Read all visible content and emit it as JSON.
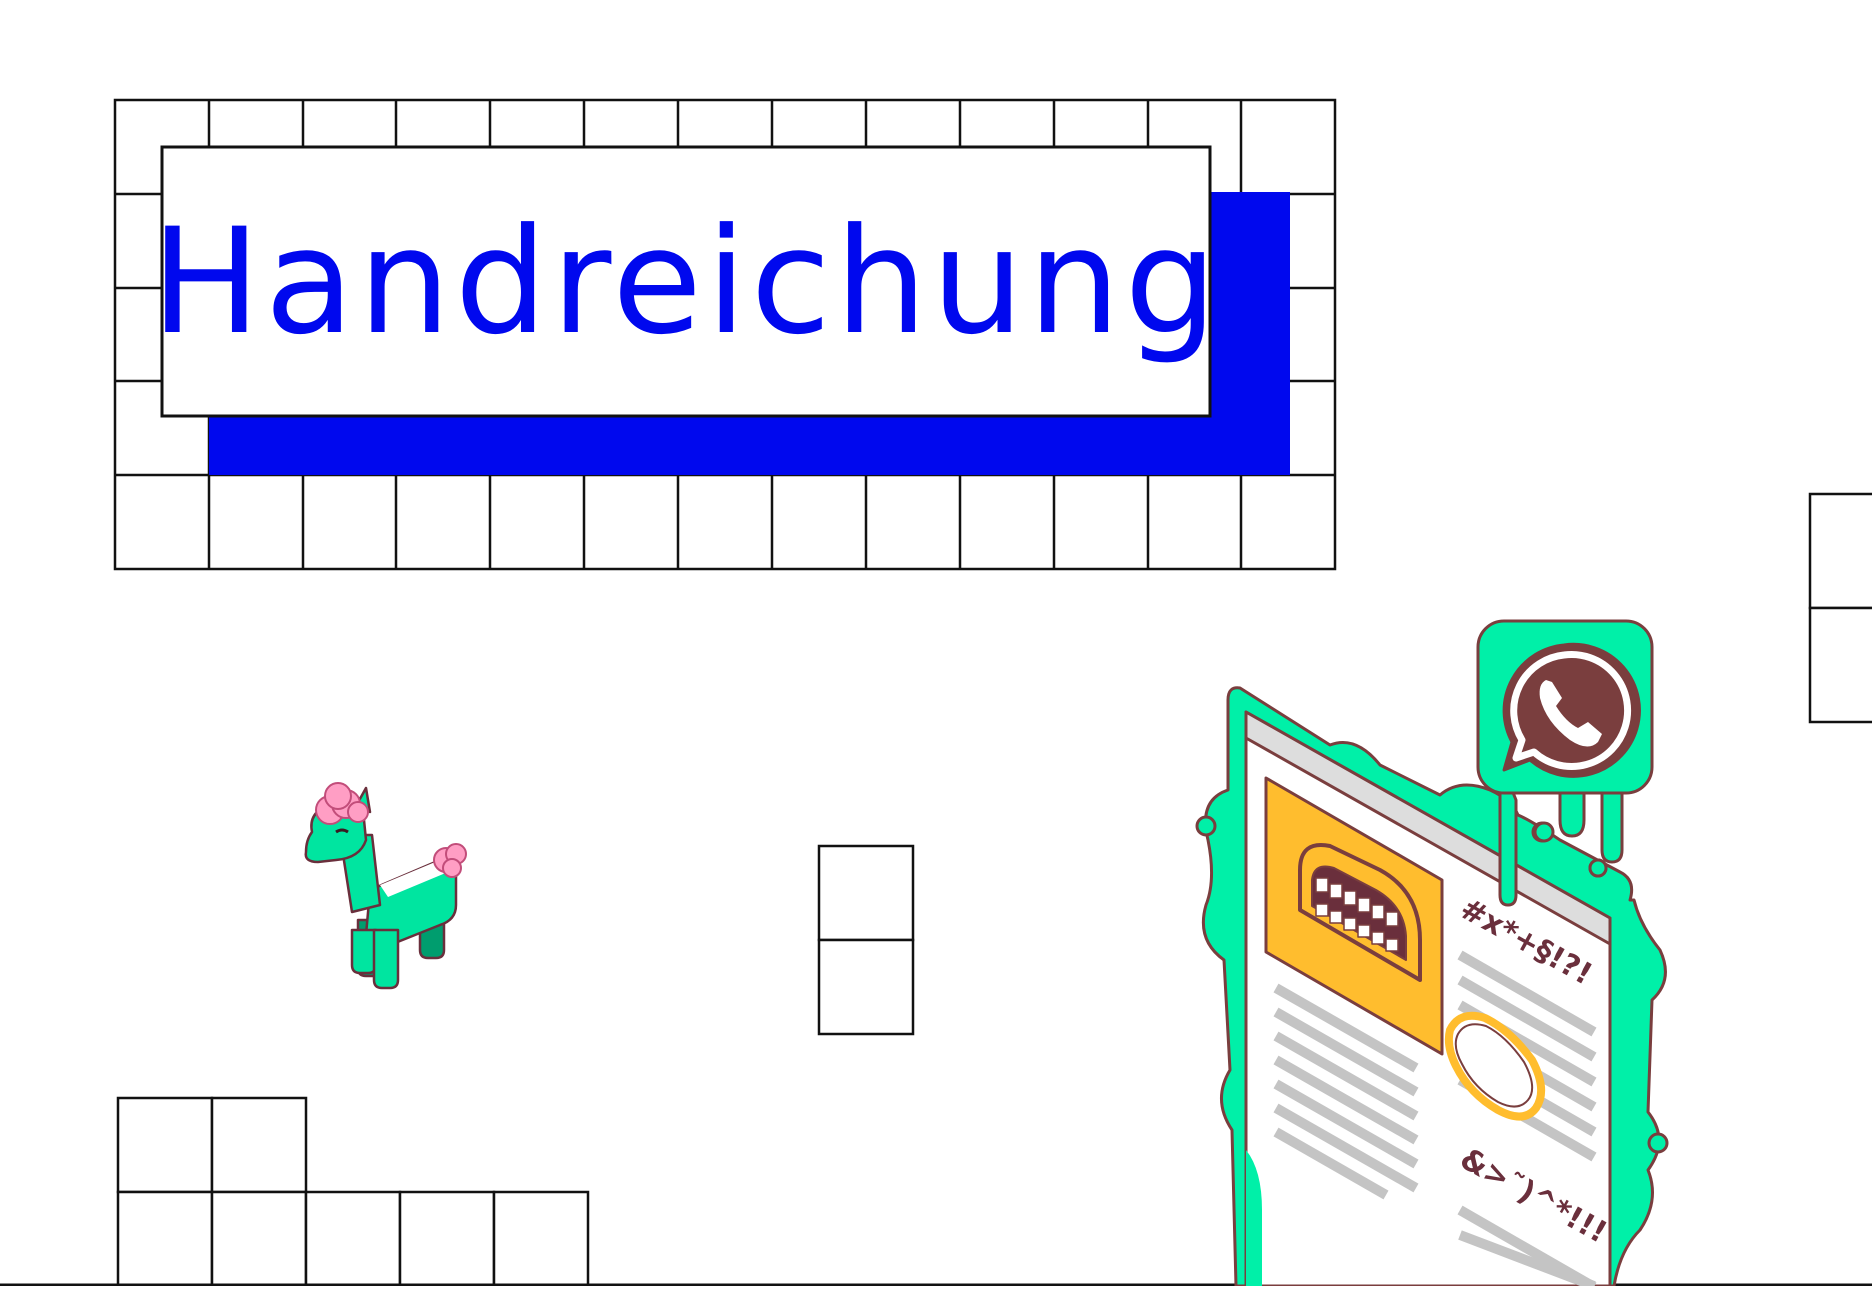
{
  "title": "Handreichung",
  "news_text_top": "#x*+§!?!",
  "news_text_bottom": "&>˜)^*!!!",
  "icons": {
    "llama": "llama-icon",
    "whatsapp": "whatsapp-icon",
    "newspaper": "newspaper-icon"
  },
  "colors": {
    "accent_blue": "#0008ee",
    "slime_green": "#00f0a8",
    "outline_brown": "#7a3e3e",
    "yellow": "#ffbd2e",
    "gray_lines": "#c4c4c4",
    "pink": "#ff9ec4"
  }
}
